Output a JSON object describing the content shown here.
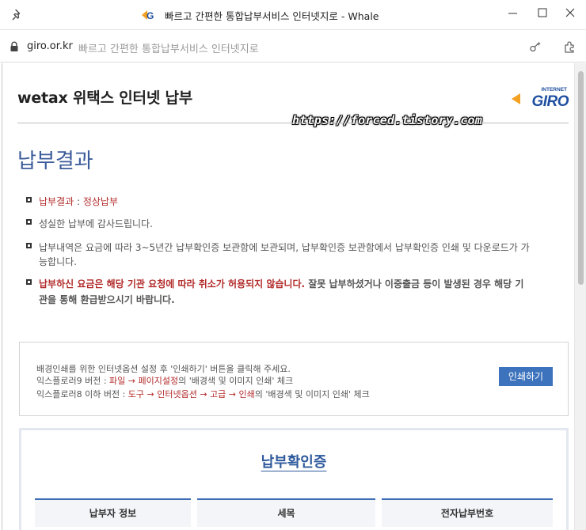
{
  "window": {
    "title": "빠르고 간편한 통합납부서비스 인터넷지로 - Whale",
    "icons": [
      "pin-icon",
      "giro-favicon",
      "minimize-icon",
      "maximize-icon",
      "close-icon"
    ]
  },
  "address_bar": {
    "url": "giro.or.kr",
    "page_title": "빠르고 간편한 통합납부서비스 인터넷지로",
    "icons": [
      "lock-icon",
      "key-icon",
      "extension-icon"
    ]
  },
  "header": {
    "site_title": "wetax 위택스 인터넷 납부",
    "logo_top": "INTERNET",
    "logo_main": "GIRO",
    "watermark": "https://forced.tistory.com"
  },
  "result": {
    "title": "납부결과",
    "status_label": "납부결과",
    "status_sep": " : ",
    "status_value": "정상납부",
    "thanks": "성실한 납부에 감사드립니다.",
    "storage_line1": "납부내역은 요금에 따라 3~5년간 납부확인증 보관함에 보관되며, 납부확인증 보관함에서 납부확인증 인쇄 및 다운로드가 가",
    "storage_line2": "능합니다.",
    "notice_red": "납부하신 요금은 해당 기관 요청에 따라 취소가 허용되지 않습니다.",
    "notice_rest": " 잘못 납부하셨거나 이중출금 등이 발생된 경우 해당 기",
    "notice_line2": "관을 통해 환급받으시기 바랍니다."
  },
  "print_section": {
    "line1": "배경인쇄를 위한 인터넷옵션 설정 후 '인쇄하기' 버튼을 클릭해 주세요.",
    "ie9_prefix": "익스플로러9 버전 : ",
    "ie9_path": "파일 → 페이지설정",
    "ie9_suffix": "의 '배경색 및 이미지 인쇄' 체크",
    "ie8_prefix": "익스플로러8 이하 버전 : ",
    "ie8_path": "도구 → 인터넷옵션 → 고급 → 인쇄",
    "ie8_suffix": "의 '배경색 및 이미지 인쇄' 체크",
    "button_label": "인쇄하기"
  },
  "certificate": {
    "title": "납부확인증",
    "columns": [
      "납부자 정보",
      "세목",
      "전자납부번호"
    ]
  },
  "colors": {
    "accent_blue": "#3d73bd",
    "title_blue": "#3b5b9a",
    "alert_red": "#b32b2b"
  }
}
